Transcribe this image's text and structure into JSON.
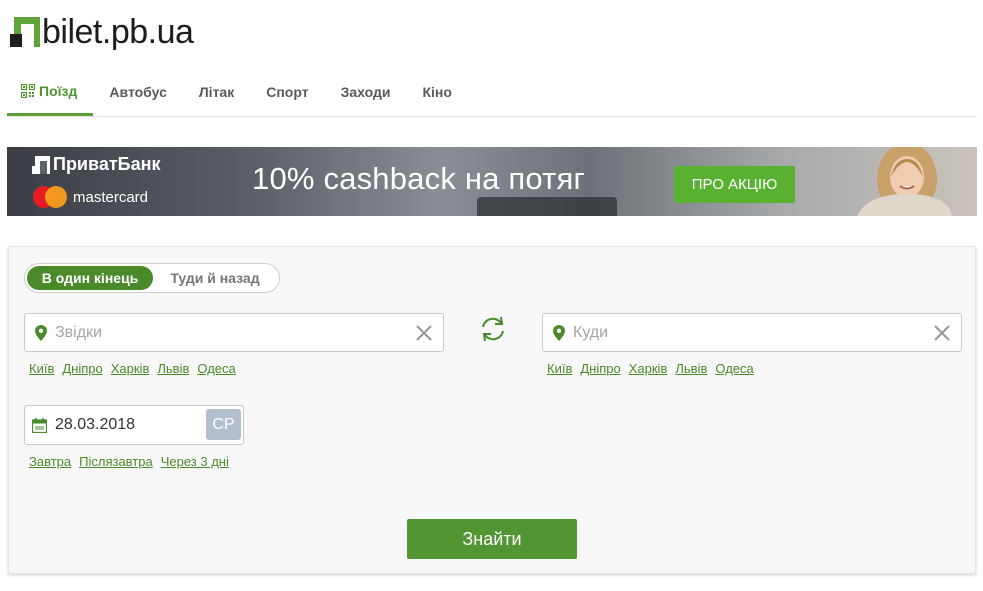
{
  "logo": {
    "text": "bilet.pb.ua"
  },
  "nav": {
    "tabs": [
      {
        "label": "Поїзд",
        "active": true
      },
      {
        "label": "Автобус"
      },
      {
        "label": "Літак"
      },
      {
        "label": "Спорт"
      },
      {
        "label": "Заходи"
      },
      {
        "label": "Кіно"
      }
    ]
  },
  "banner": {
    "bank": "ПриватБанк",
    "card": "mastercard",
    "headline": "10% cashback на потяг",
    "cta": "ПРО АКЦІЮ"
  },
  "search": {
    "trip_type": {
      "one_way": "В один кінець",
      "round_trip": "Туди й назад"
    },
    "from": {
      "placeholder": "Звідки"
    },
    "to": {
      "placeholder": "Куди"
    },
    "popular_cities": [
      "Київ",
      "Дніпро",
      "Харків",
      "Львів",
      "Одеса"
    ],
    "date": {
      "value": "28.03.2018",
      "weekday": "СР"
    },
    "quick_dates": [
      "Завтра",
      "Післязавтра",
      "Через 3 дні"
    ],
    "submit": "Знайти"
  },
  "colors": {
    "accent": "#4a8a2b",
    "button": "#529634",
    "promo": "#58b131"
  }
}
